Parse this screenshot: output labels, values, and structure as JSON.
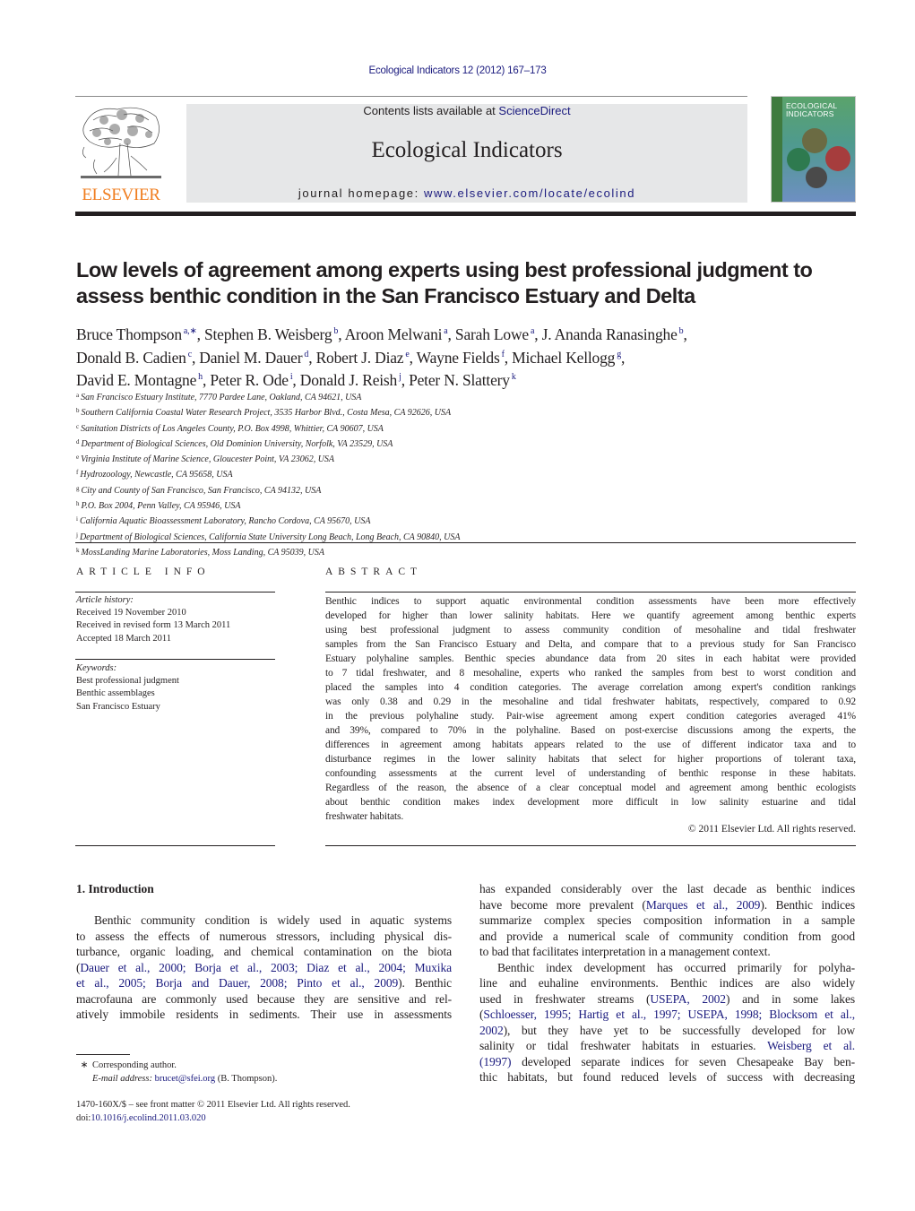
{
  "header": {
    "journal_ref": "Ecological Indicators 12 (2012) 167–173",
    "publisher_logo_text": "ELSEVIER",
    "contents_prefix": "Contents lists available at ",
    "contents_link": "ScienceDirect",
    "journal_title": "Ecological Indicators",
    "homepage_prefix": "journal homepage: ",
    "homepage_link": "www.elsevier.com/locate/ecolind",
    "cover_title_line1": "ECOLOGICAL",
    "cover_title_line2": "INDICATORS",
    "colors": {
      "brand_orange": "#f07d1f",
      "link_blue": "#1a1a7e",
      "banner_gray": "#e6e7e8"
    }
  },
  "article": {
    "title_lines": [
      "Low levels of agreement among experts using best professional judgment to",
      "assess benthic condition in the San Francisco Estuary and Delta"
    ],
    "authors": [
      {
        "name": "Bruce Thompson",
        "sup": "a,∗",
        "sep": ", "
      },
      {
        "name": "Stephen B. Weisberg",
        "sup": "b",
        "sep": ", "
      },
      {
        "name": "Aroon Melwani",
        "sup": "a",
        "sep": ", "
      },
      {
        "name": "Sarah Lowe",
        "sup": "a",
        "sep": ", "
      },
      {
        "name": "J. Ananda Ranasinghe",
        "sup": "b",
        "sep": ","
      },
      {
        "name": "Donald B. Cadien",
        "sup": "c",
        "sep": ", "
      },
      {
        "name": "Daniel M. Dauer",
        "sup": "d",
        "sep": ", "
      },
      {
        "name": "Robert J. Diaz",
        "sup": "e",
        "sep": ", "
      },
      {
        "name": "Wayne Fields",
        "sup": "f",
        "sep": ", "
      },
      {
        "name": "Michael Kellogg",
        "sup": "g",
        "sep": ","
      },
      {
        "name": "David E. Montagne",
        "sup": "h",
        "sep": ", "
      },
      {
        "name": "Peter R. Ode",
        "sup": "i",
        "sep": ", "
      },
      {
        "name": "Donald J. Reish",
        "sup": "j",
        "sep": ", "
      },
      {
        "name": "Peter N. Slattery",
        "sup": "k",
        "sep": ""
      }
    ],
    "affiliations": [
      {
        "key": "a",
        "text": "San Francisco Estuary Institute, 7770 Pardee Lane, Oakland, CA 94621, USA"
      },
      {
        "key": "b",
        "text": "Southern California Coastal Water Research Project, 3535 Harbor Blvd., Costa Mesa, CA 92626, USA"
      },
      {
        "key": "c",
        "text": "Sanitation Districts of Los Angeles County, P.O. Box 4998, Whittier, CA 90607, USA"
      },
      {
        "key": "d",
        "text": "Department of Biological Sciences, Old Dominion University, Norfolk, VA 23529, USA"
      },
      {
        "key": "e",
        "text": "Virginia Institute of Marine Science, Gloucester Point, VA 23062, USA"
      },
      {
        "key": "f",
        "text": "Hydrozoology, Newcastle, CA 95658, USA"
      },
      {
        "key": "g",
        "text": "City and County of San Francisco, San Francisco, CA 94132, USA"
      },
      {
        "key": "h",
        "text": "P.O. Box 2004, Penn Valley, CA 95946, USA"
      },
      {
        "key": "i",
        "text": "California Aquatic Bioassessment Laboratory, Rancho Cordova, CA 95670, USA"
      },
      {
        "key": "j",
        "text": "Department of Biological Sciences, California State University Long Beach, Long Beach, CA 90840, USA"
      },
      {
        "key": "k",
        "text": "MossLanding Marine Laboratories, Moss Landing, CA 95039, USA"
      }
    ]
  },
  "article_info": {
    "heading": "ARTICLE INFO",
    "history_label": "Article history:",
    "history": [
      "Received 19 November 2010",
      "Received in revised form 13 March 2011",
      "Accepted 18 March 2011"
    ],
    "keywords_label": "Keywords:",
    "keywords": [
      "Best professional judgment",
      "Benthic assemblages",
      "San Francisco Estuary"
    ]
  },
  "abstract": {
    "heading": "ABSTRACT",
    "lines": [
      "Benthic indices to support aquatic environmental condition assessments have been more effectively",
      "developed for higher than lower salinity habitats. Here we quantify agreement among benthic experts",
      "using best professional judgment to assess community condition of mesohaline and tidal freshwater",
      "samples from the San Francisco Estuary and Delta, and compare that to a previous study for San Francisco",
      "Estuary polyhaline samples. Benthic species abundance data from 20 sites in each habitat were provided",
      "to 7 tidal freshwater, and 8 mesohaline, experts who ranked the samples from best to worst condition and",
      "placed the samples into 4 condition categories. The average correlation among expert's condition rankings",
      "was only 0.38 and 0.29 in the mesohaline and tidal freshwater habitats, respectively, compared to 0.92",
      "in the previous polyhaline study. Pair-wise agreement among expert condition categories averaged 41%",
      "and 39%, compared to 70% in the polyhaline. Based on post-exercise discussions among the experts, the",
      "differences in agreement among habitats appears related to the use of different indicator taxa and to",
      "disturbance regimes in the lower salinity habitats that select for higher proportions of tolerant taxa,",
      "confounding assessments at the current level of understanding of benthic response in these habitats.",
      "Regardless of the reason, the absence of a clear conceptual model and agreement among benthic ecologists",
      "about benthic condition makes index development more difficult in low salinity estuarine and tidal",
      "freshwater habitats."
    ],
    "copyright": "© 2011 Elsevier Ltd. All rights reserved."
  },
  "introduction": {
    "heading": "1.  Introduction",
    "left_lines": [
      {
        "text": "Benthic community condition is widely used in aquatic systems",
        "indent": true
      },
      {
        "text": "to assess the effects of numerous stressors, including physical dis-"
      },
      {
        "text": "turbance, organic loading, and chemical contamination on the biota"
      },
      {
        "segments": [
          {
            "t": "(",
            "link": false
          },
          {
            "t": "Dauer et al., 2000; Borja et al., 2003; Diaz et al., 2004; Muxika",
            "link": true
          }
        ]
      },
      {
        "segments": [
          {
            "t": "et al., 2005; Borja and Dauer, 2008; Pinto et al., 2009",
            "link": true
          },
          {
            "t": "). Benthic",
            "link": false
          }
        ]
      },
      {
        "text": "macrofauna are commonly used because they are sensitive and rel-"
      },
      {
        "text": "atively immobile residents in sediments. Their use in assessments"
      }
    ],
    "right_lines": [
      {
        "text": "has expanded considerably over the last decade as benthic indices"
      },
      {
        "segments": [
          {
            "t": "have become more prevalent (",
            "link": false
          },
          {
            "t": "Marques et al., 2009",
            "link": true
          },
          {
            "t": "). Benthic indices",
            "link": false
          }
        ]
      },
      {
        "text": "summarize complex species composition information in a sample"
      },
      {
        "text": "and provide a numerical scale of community condition from good"
      },
      {
        "text": "to bad that facilitates interpretation in a management context.",
        "last": true
      },
      {
        "text": "Benthic index development has occurred primarily for polyha-",
        "indent": true
      },
      {
        "text": "line and euhaline environments. Benthic indices are also widely"
      },
      {
        "segments": [
          {
            "t": "used in freshwater streams (",
            "link": false
          },
          {
            "t": "USEPA, 2002",
            "link": true
          },
          {
            "t": ") and in some lakes",
            "link": false
          }
        ]
      },
      {
        "segments": [
          {
            "t": "(",
            "link": false
          },
          {
            "t": "Schloesser, 1995; Hartig et al., 1997; USEPA, 1998; Blocksom et al.,",
            "link": true
          }
        ]
      },
      {
        "segments": [
          {
            "t": "2002",
            "link": true
          },
          {
            "t": "), but they have yet to be successfully developed for low",
            "link": false
          }
        ]
      },
      {
        "segments": [
          {
            "t": "salinity or tidal freshwater habitats in estuaries. ",
            "link": false
          },
          {
            "t": "Weisberg et al.",
            "link": true
          }
        ]
      },
      {
        "segments": [
          {
            "t": "(1997)",
            "link": true
          },
          {
            "t": " developed separate indices for seven Chesapeake Bay ben-",
            "link": false
          }
        ]
      },
      {
        "text": "thic habitats, but found reduced levels of success with decreasing"
      }
    ]
  },
  "footnotes": {
    "star": "∗",
    "corresponding": "Corresponding author.",
    "email_label": "E-mail address:",
    "email": "brucet@sfei.org",
    "email_suffix": " (B. Thompson).",
    "front_matter": "1470-160X/$ – see front matter © 2011 Elsevier Ltd. All rights reserved.",
    "doi_prefix": "doi:",
    "doi": "10.1016/j.ecolind.2011.03.020"
  }
}
